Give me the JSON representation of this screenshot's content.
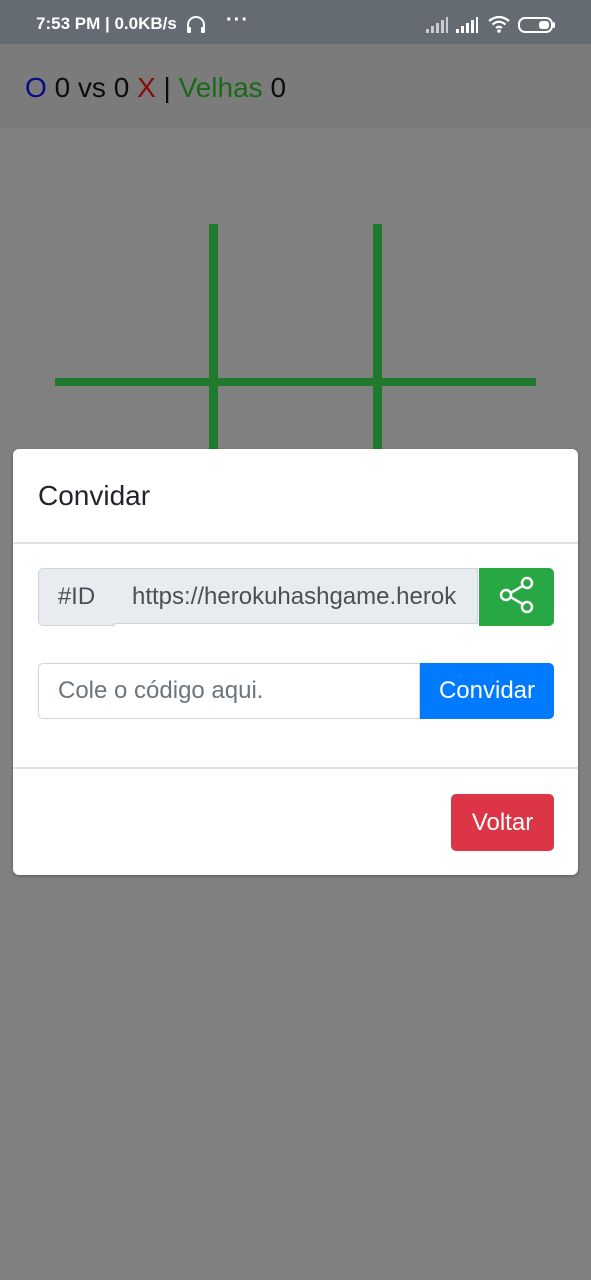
{
  "status_bar": {
    "time_speed": "7:53 PM | 0.0KB/s",
    "more": "···",
    "icons": [
      "headset-icon",
      "signal-icon",
      "signal-icon",
      "wifi-icon",
      "battery-icon"
    ]
  },
  "score": {
    "o_symbol": "O",
    "o_score": "0",
    "vs": "vs",
    "x_score": "0",
    "x_symbol": "X",
    "separator": "|",
    "velhas_label": "Velhas",
    "velhas_score": "0"
  },
  "board": {
    "line_color": "#1f7a2e"
  },
  "modal": {
    "title": "Convidar",
    "id_prefix": "#ID",
    "id_value": "https://herokuhashgame.herok",
    "share_icon": "share-icon",
    "code_placeholder": "Cole o código aqui.",
    "invite_label": "Convidar",
    "back_label": "Voltar"
  },
  "colors": {
    "share_button": "#28a745",
    "invite_button": "#007bff",
    "back_button": "#dc3545",
    "overlay": "#808080"
  }
}
